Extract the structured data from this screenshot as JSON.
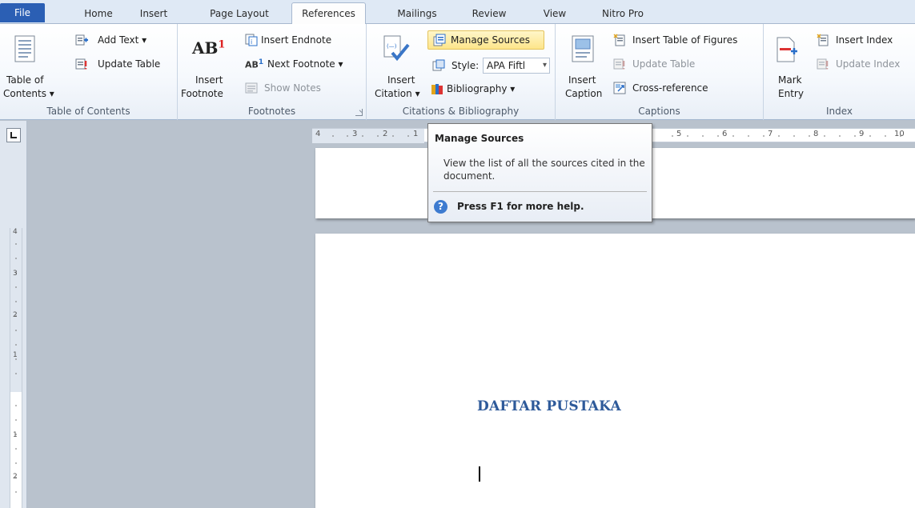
{
  "tabs": [
    "File",
    "Home",
    "Insert",
    "Page Layout",
    "References",
    "Mailings",
    "Review",
    "View",
    "Nitro Pro"
  ],
  "active_tab": "References",
  "groups": {
    "toc": {
      "label": "Table of Contents",
      "toc_button": [
        "Table of",
        "Contents ▾"
      ],
      "add_text": "Add Text ▾",
      "update_table": "Update Table"
    },
    "footnotes": {
      "label": "Footnotes",
      "insert_footnote": [
        "Insert",
        "Footnote"
      ],
      "insert_endnote": "Insert Endnote",
      "next_footnote": "Next Footnote ▾",
      "show_notes": "Show Notes"
    },
    "citations": {
      "label": "Citations & Bibliography",
      "insert_citation": [
        "Insert",
        "Citation ▾"
      ],
      "manage_sources": "Manage Sources",
      "style_label": "Style:",
      "style_value": "APA Fiftl",
      "bibliography": "Bibliography ▾"
    },
    "captions": {
      "label": "Captions",
      "insert_caption": [
        "Insert",
        "Caption"
      ],
      "insert_table_of_figures": "Insert Table of Figures",
      "update_table": "Update Table",
      "cross_reference": "Cross-reference"
    },
    "index": {
      "label": "Index",
      "mark_entry": [
        "Mark",
        "Entry"
      ],
      "insert_index": "Insert Index",
      "update_index": "Update Index"
    }
  },
  "tooltip": {
    "title": "Manage Sources",
    "body": "View the list of all the sources cited in the document.",
    "help": "Press F1 for more help."
  },
  "document": {
    "heading": "DAFTAR PUSTAKA"
  },
  "rulers": {
    "horizontal_labels": [
      "4",
      "3",
      "2",
      "1",
      "5",
      "6",
      "7",
      "8",
      "9",
      "10"
    ],
    "vertical_labels": [
      "4",
      "3",
      "2",
      "1",
      "1",
      "2"
    ]
  },
  "colors": {
    "file_tab": "#2b5fb4",
    "heading": "#2e5a9a",
    "highlight": "#fde58a"
  }
}
